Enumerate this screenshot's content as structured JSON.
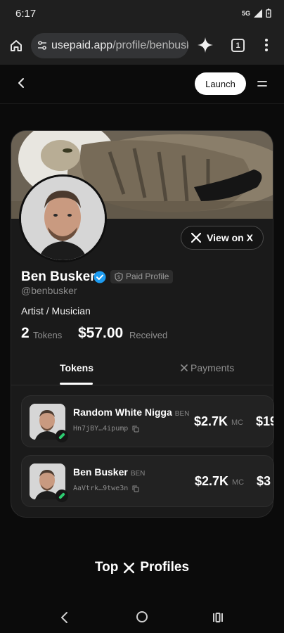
{
  "status": {
    "time": "6:17",
    "network": "5G"
  },
  "browser": {
    "url_domain": "usepaid.app",
    "url_path": "/profile/benbusk",
    "tab_count": "1"
  },
  "header": {
    "launch_label": "Launch"
  },
  "profile": {
    "name": "Ben Busker",
    "badge": "Paid Profile",
    "handle": "@benbusker",
    "bio": "Artist / Musician",
    "view_on_x": "View on X",
    "tokens_count": "2",
    "tokens_label": "Tokens",
    "received_amount": "$57.00",
    "received_label": "Received"
  },
  "tabs": [
    {
      "label": "Tokens",
      "active": true
    },
    {
      "label": "Payments",
      "active": false
    }
  ],
  "tokens": [
    {
      "name": "Random White Nigga",
      "ticker": "BEN",
      "address": "Hn7jBY…4ipump",
      "market_cap": "$2.7K",
      "mc_label": "MC",
      "extra": "$19"
    },
    {
      "name": "Ben Busker",
      "ticker": "BEN",
      "address": "AaVtrk…9twe3n",
      "market_cap": "$2.7K",
      "mc_label": "MC",
      "extra": "$3"
    }
  ],
  "footer": {
    "title_left": "Top",
    "title_right": "Profiles"
  },
  "icons": {
    "home": "home-icon",
    "tune": "site-settings-icon",
    "sparkle": "sparkle-icon",
    "more": "more-vert-icon",
    "back": "chevron-left-icon",
    "menu": "hamburger-icon",
    "verified": "verified-check-icon",
    "x": "x-logo-icon",
    "copy": "copy-icon"
  },
  "colors": {
    "verified": "#1d9bf0",
    "pill": "#2ecc71",
    "background": "#0b0b0b"
  }
}
